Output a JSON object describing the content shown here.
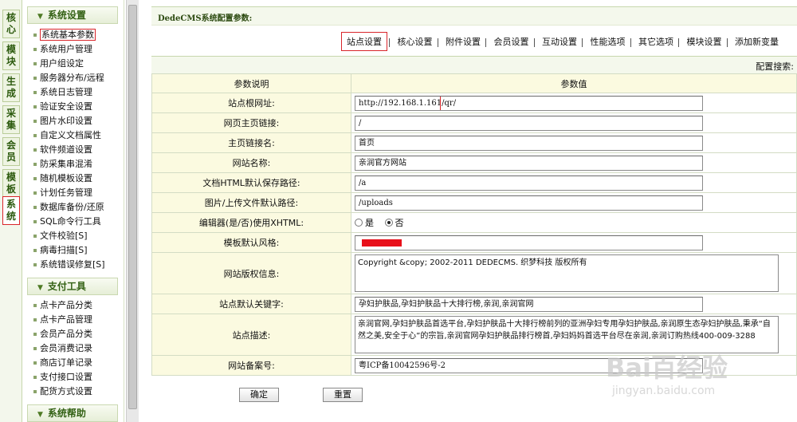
{
  "vertical_tabs": [
    "核心",
    "模块",
    "生成",
    "采集",
    "会员",
    "模板",
    "系统"
  ],
  "sidebar": {
    "groups": [
      {
        "title": "系统设置",
        "items": [
          "系统基本参数",
          "系统用户管理",
          "用户组设定",
          "服务器分布/远程",
          "系统日志管理",
          "验证安全设置",
          "图片水印设置",
          "自定义文档属性",
          "软件频道设置",
          "防采集串混淆",
          "随机模板设置",
          "计划任务管理",
          "数据库备份/还原",
          "SQL命令行工具",
          "文件校验[S]",
          "病毒扫描[S]",
          "系统错误修复[S]"
        ]
      },
      {
        "title": "支付工具",
        "items": [
          "点卡产品分类",
          "点卡产品管理",
          "会员产品分类",
          "会员消费记录",
          "商店订单记录",
          "支付接口设置",
          "配货方式设置"
        ]
      },
      {
        "title": "系统帮助",
        "items": []
      }
    ]
  },
  "main": {
    "heading": "DedeCMS系统配置参数:",
    "tabs": [
      "站点设置",
      "核心设置",
      "附件设置",
      "会员设置",
      "互动设置",
      "性能选项",
      "其它选项",
      "模块设置",
      "添加新变量"
    ],
    "search_label": "配置搜索:",
    "table_headers": [
      "参数说明",
      "参数值"
    ],
    "rows": {
      "r0": {
        "label": "站点根网址:",
        "value": "http://192.168.1.161/qr/"
      },
      "r1": {
        "label": "网页主页链接:",
        "value": "/"
      },
      "r2": {
        "label": "主页链接名:",
        "value": "首页"
      },
      "r3": {
        "label": "网站名称:",
        "value": "亲润官方网站"
      },
      "r4": {
        "label": "文档HTML默认保存路径:",
        "value": "/a"
      },
      "r5": {
        "label": "图片/上传文件默认路径:",
        "value": "/uploads"
      },
      "r6": {
        "label": "编辑器(是/否)使用XHTML:",
        "options": [
          "是",
          "否"
        ],
        "selected": "否"
      },
      "r7": {
        "label": "模板默认风格:",
        "value": ""
      },
      "r8": {
        "label": "网站版权信息:",
        "value": "Copyright &copy; 2002-2011 DEDECMS. 织梦科技 版权所有"
      },
      "r9": {
        "label": "站点默认关键字:",
        "value": "孕妇护肤品,孕妇护肤品十大排行榜,亲润,亲润官网"
      },
      "r10": {
        "label": "站点描述:",
        "value": "亲润官网,孕妇护肤品首选平台,孕妇护肤品十大排行榜前列的亚洲孕妇专用孕妇护肤品,亲润原生态孕妇护肤品,秉承“自然之美,安全于心”的宗旨,亲润官网孕妇护肤品排行榜首,孕妇妈妈首选平台尽在亲润,亲润订购热线400-009-3288"
      },
      "r11": {
        "label": "网站备案号:",
        "value": "粤ICP备10042596号-2"
      }
    },
    "buttons": {
      "confirm": "确定",
      "reset": "重置"
    }
  },
  "watermark": {
    "line1": "Bai百经验",
    "line2": "jingyan.baidu.com"
  },
  "colors": {
    "highlight_border": "#d9252a",
    "label_bg": "#fbfae0",
    "header_bg": "#f4f8ec"
  }
}
